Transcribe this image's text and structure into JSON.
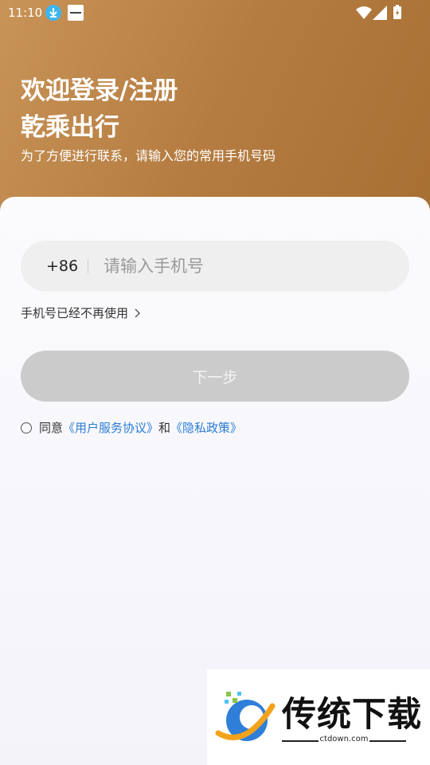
{
  "status_bar": {
    "time": "11:10",
    "icons": [
      "download-icon",
      "app-notification-icon",
      "wifi-icon",
      "signal-icon",
      "battery-icon"
    ]
  },
  "header": {
    "title_line1": "欢迎登录/注册",
    "title_line2": "乾乘出行",
    "subtitle": "为了方便进行联系，请输入您的常用手机号码"
  },
  "login_form": {
    "country_code": "+86",
    "phone_placeholder": "请输入手机号",
    "phone_value": "",
    "no_longer_used_link": "手机号已经不再使用",
    "next_button": "下一步",
    "agreement": {
      "prefix": "同意",
      "user_agreement": "《用户服务协议》",
      "and": "和",
      "privacy_policy": "《隐私政策》"
    }
  },
  "watermark": {
    "brand": "传统下载",
    "domain": "ctdown.com"
  },
  "colors": {
    "header_gradient_start": "#c99458",
    "header_gradient_end": "#a86f33",
    "link_blue": "#2a7dd4",
    "disabled_button": "#cbcbcb"
  }
}
